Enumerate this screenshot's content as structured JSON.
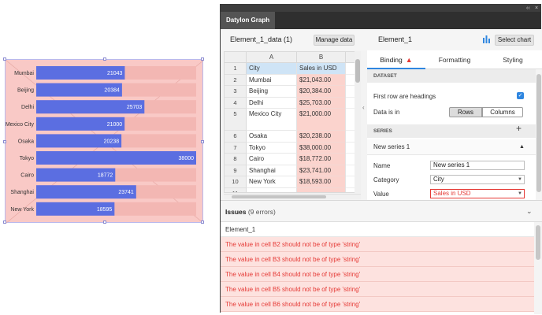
{
  "chart_data": {
    "type": "bar",
    "categories": [
      "Mumbai",
      "Beijing",
      "Delhi",
      "Mexico City",
      "Osaka",
      "Tokyo",
      "Cairo",
      "Shanghai",
      "New York"
    ],
    "values": [
      21043,
      20384,
      25703,
      21000,
      20238,
      38000,
      18772,
      23741,
      18595
    ],
    "value_labels": [
      "21043",
      "20384",
      "25703",
      "21000",
      "20238",
      "38000",
      "18772",
      "23741",
      "18595"
    ],
    "xlim": [
      0,
      38000
    ],
    "title": "",
    "xlabel": "",
    "ylabel": "",
    "grid": false,
    "colors": {
      "bar": "#5b6ee1",
      "bar_background": "#f3b7b3",
      "canvas": "#f9c9c6"
    }
  },
  "window": {
    "title": "Datylon Graph",
    "controls": [
      "‹‹",
      "×"
    ]
  },
  "data_panel": {
    "title": "Element_1_data (1)",
    "manage_label": "Manage data",
    "columns": [
      "A",
      "B"
    ],
    "rows": [
      {
        "n": "1",
        "a": "City",
        "b": "Sales in USD"
      },
      {
        "n": "2",
        "a": "Mumbai",
        "b": "$21,043.00"
      },
      {
        "n": "3",
        "a": "Beijing",
        "b": "$20,384.00"
      },
      {
        "n": "4",
        "a": "Delhi",
        "b": "$25,703.00"
      },
      {
        "n": "5",
        "a": "Mexico City",
        "b": "$21,000.00"
      },
      {
        "n": "6",
        "a": "Osaka",
        "b": "$20,238.00"
      },
      {
        "n": "7",
        "a": "Tokyo",
        "b": "$38,000.00"
      },
      {
        "n": "8",
        "a": "Cairo",
        "b": "$18,772.00"
      },
      {
        "n": "9",
        "a": "Shanghai",
        "b": "$23,741.00"
      },
      {
        "n": "10",
        "a": "New York",
        "b": "$18,593.00"
      },
      {
        "n": "11",
        "a": "",
        "b": ""
      }
    ]
  },
  "element_panel": {
    "title": "Element_1",
    "select_chart_label": "Select chart",
    "tabs": {
      "binding": "Binding",
      "formatting": "Formatting",
      "styling": "Styling"
    },
    "dataset_section": "DATASET",
    "first_row_label": "First row are headings",
    "data_is_in_label": "Data is in",
    "rows_label": "Rows",
    "columns_label": "Columns",
    "series_section": "SERIES",
    "series_item": "New series 1",
    "name_label": "Name",
    "name_value": "New series 1",
    "category_label": "Category",
    "category_value": "City",
    "value_label": "Value",
    "value_value": "Sales in USD"
  },
  "issues": {
    "title": "Issues",
    "count": "(9 errors)",
    "element": "Element_1",
    "messages": [
      "The value in cell B2 should not be of type 'string'",
      "The value in cell B3 should not be of type 'string'",
      "The value in cell B4 should not be of type 'string'",
      "The value in cell B5 should not be of type 'string'",
      "The value in cell B6 should not be of type 'string'"
    ]
  }
}
